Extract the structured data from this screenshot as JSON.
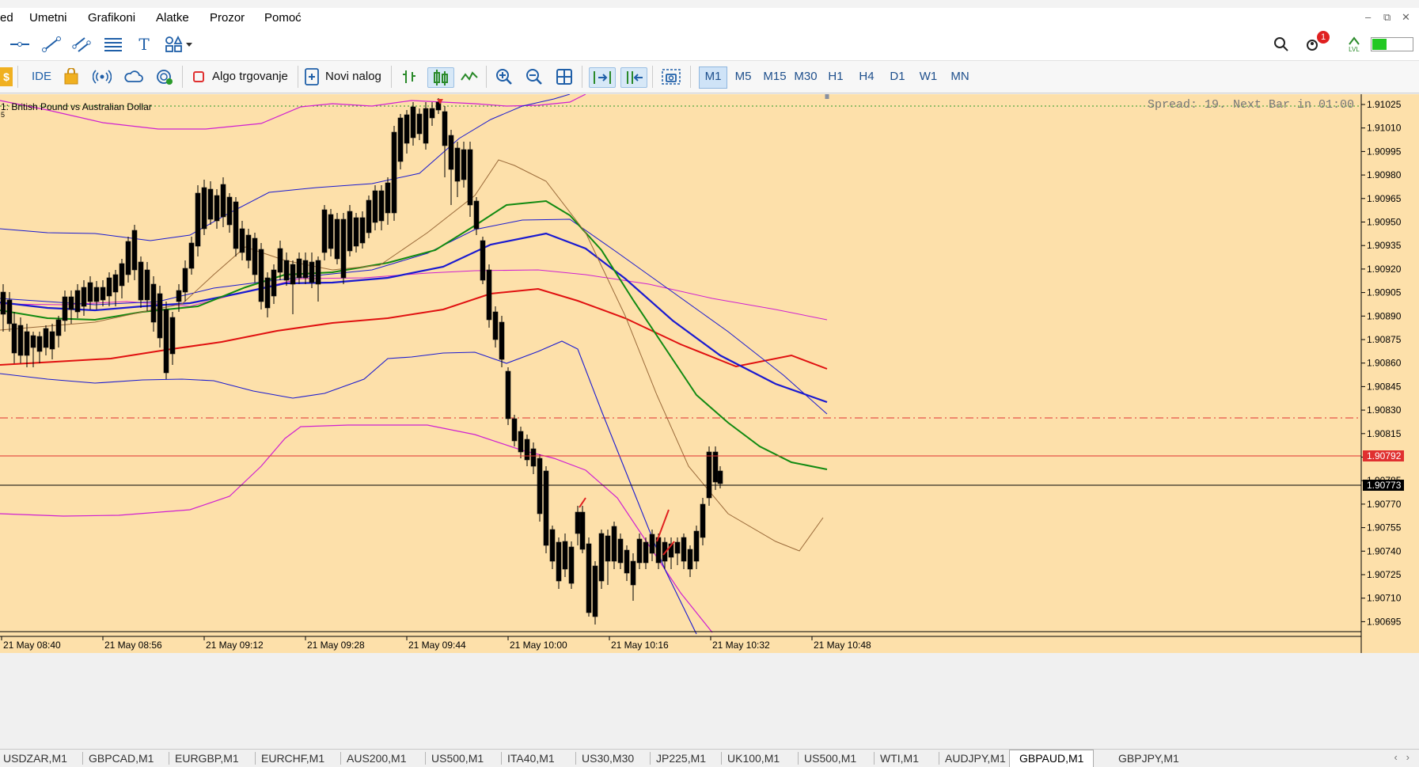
{
  "menu": {
    "partial_item": "ed",
    "items": [
      "Umetni",
      "Grafikoni",
      "Alatke",
      "Prozor",
      "Pomoć"
    ]
  },
  "toolbar": {
    "ide_label": "IDE",
    "algo_label": "Algo trgovanje",
    "new_order_label": "Novi nalog",
    "notification_count": "1",
    "signal_label": "LVL",
    "timeframes": [
      "M1",
      "M5",
      "M15",
      "M30",
      "H1",
      "H4",
      "D1",
      "W1",
      "MN"
    ],
    "active_timeframe": "M1"
  },
  "chart": {
    "symbol_title": "1:  British Pound vs Australian Dollar",
    "symbol_sub": "5",
    "info_text": "Spread: 19. Next Bar in 01:00",
    "price_levels": [
      "1.91025",
      "1.91010",
      "1.90995",
      "1.90980",
      "1.90965",
      "1.90950",
      "1.90935",
      "1.90920",
      "1.90905",
      "1.90890",
      "1.90875",
      "1.90860",
      "1.90845",
      "1.90830",
      "1.90815",
      "1.90800",
      "1.90785",
      "1.90770",
      "1.90755",
      "1.90740",
      "1.90725",
      "1.90710",
      "1.90695"
    ],
    "ask_price": "1.90792",
    "bid_price": "1.90773",
    "time_labels": [
      "21 May 08:40",
      "21 May 08:56",
      "21 May 09:12",
      "21 May 09:28",
      "21 May 09:44",
      "21 May 10:00",
      "21 May 10:16",
      "21 May 10:32",
      "21 May 10:48"
    ],
    "colors": {
      "background": "#fde0aa",
      "bull_candle": "#8aa826",
      "bear_candle": "#000000",
      "ma_red": "#e01010",
      "ma_blue": "#1a1ad0",
      "ma_green": "#118a11",
      "bollinger": "#d020d0",
      "ask_line": "#e03030"
    }
  },
  "symbol_tabs": [
    "USDZAR,M1",
    "GBPCAD,M1",
    "EURGBP,M1",
    "EURCHF,M1",
    "AUS200,M1",
    "US500,M1",
    "ITA40,M1",
    "US30,M30",
    "JP225,M1",
    "UK100,M1",
    "US500,M1",
    "WTI,M1",
    "AUDJPY,M1",
    "GBPAUD,M1",
    "GBPJPY,M1"
  ],
  "active_tab": "GBPAUD,M1"
}
